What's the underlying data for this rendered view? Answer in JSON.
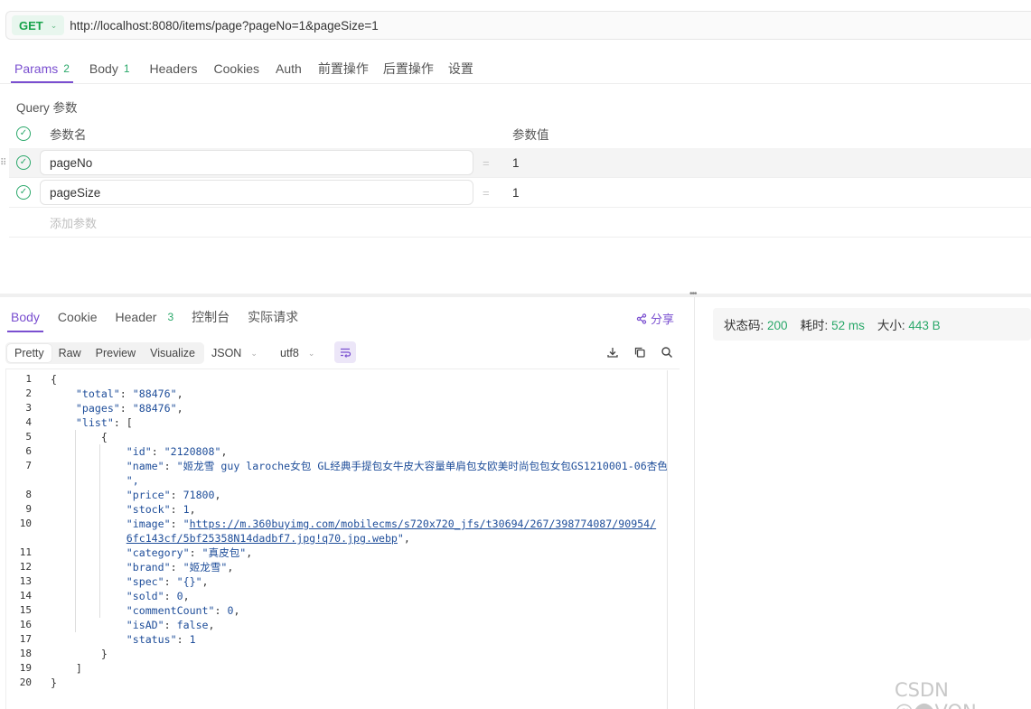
{
  "request": {
    "method": "GET",
    "url": "http://localhost:8080/items/page?pageNo=1&pageSize=1"
  },
  "request_tabs": [
    {
      "label": "Params",
      "count": "2"
    },
    {
      "label": "Body",
      "count": "1"
    },
    {
      "label": "Headers",
      "count": ""
    },
    {
      "label": "Cookies",
      "count": ""
    },
    {
      "label": "Auth",
      "count": ""
    },
    {
      "label": "前置操作",
      "count": ""
    },
    {
      "label": "后置操作",
      "count": ""
    },
    {
      "label": "设置",
      "count": ""
    }
  ],
  "query": {
    "title": "Query 参数",
    "header_name": "参数名",
    "header_value": "参数值",
    "params": [
      {
        "name": "pageNo",
        "value": "1"
      },
      {
        "name": "pageSize",
        "value": "1"
      }
    ],
    "add_placeholder": "添加参数",
    "equals": "="
  },
  "response_tabs": [
    {
      "label": "Body",
      "count": ""
    },
    {
      "label": "Cookie",
      "count": ""
    },
    {
      "label": "Header",
      "count": "3"
    },
    {
      "label": "控制台",
      "count": ""
    },
    {
      "label": "实际请求",
      "count": ""
    }
  ],
  "share_label": "分享",
  "format_buttons": [
    "Pretty",
    "Raw",
    "Preview",
    "Visualize"
  ],
  "selects": {
    "format": "JSON",
    "encoding": "utf8"
  },
  "status": {
    "code_label": "状态码:",
    "code": "200",
    "time_label": "耗时:",
    "time": "52 ms",
    "size_label": "大小:",
    "size": "443 B"
  },
  "code_lines": [
    {
      "no": "1",
      "text": "{"
    },
    {
      "no": "2",
      "text": "    \"total\": \"88476\","
    },
    {
      "no": "3",
      "text": "    \"pages\": \"88476\","
    },
    {
      "no": "4",
      "text": "    \"list\": ["
    },
    {
      "no": "5",
      "text": "        {"
    },
    {
      "no": "6",
      "text": "            \"id\": \"2120808\","
    },
    {
      "no": "7",
      "text": "            \"name\": \"姬龙雪 guy laroche女包 GL经典手提包女牛皮大容量单肩包女欧美时尚包包女包GS1210001-06杏色"
    },
    {
      "no": "",
      "text": "            \","
    },
    {
      "no": "8",
      "text": "            \"price\": 71800,"
    },
    {
      "no": "9",
      "text": "            \"stock\": 1,"
    },
    {
      "no": "10",
      "text": "            \"image\": \"https://m.360buyimg.com/mobilecms/s720x720_jfs/t30694/267/398774087/90954/"
    },
    {
      "no": "",
      "text": "            6fc143cf/5bf25358N14dadbf7.jpg!q70.jpg.webp\","
    },
    {
      "no": "11",
      "text": "            \"category\": \"真皮包\","
    },
    {
      "no": "12",
      "text": "            \"brand\": \"姬龙雪\","
    },
    {
      "no": "13",
      "text": "            \"spec\": \"{}\","
    },
    {
      "no": "14",
      "text": "            \"sold\": 0,"
    },
    {
      "no": "15",
      "text": "            \"commentCount\": 0,"
    },
    {
      "no": "16",
      "text": "            \"isAD\": false,"
    },
    {
      "no": "17",
      "text": "            \"status\": 1"
    },
    {
      "no": "18",
      "text": "        }"
    },
    {
      "no": "19",
      "text": "    ]"
    },
    {
      "no": "20",
      "text": "}"
    }
  ],
  "watermark": "CSDN @⬤VON"
}
